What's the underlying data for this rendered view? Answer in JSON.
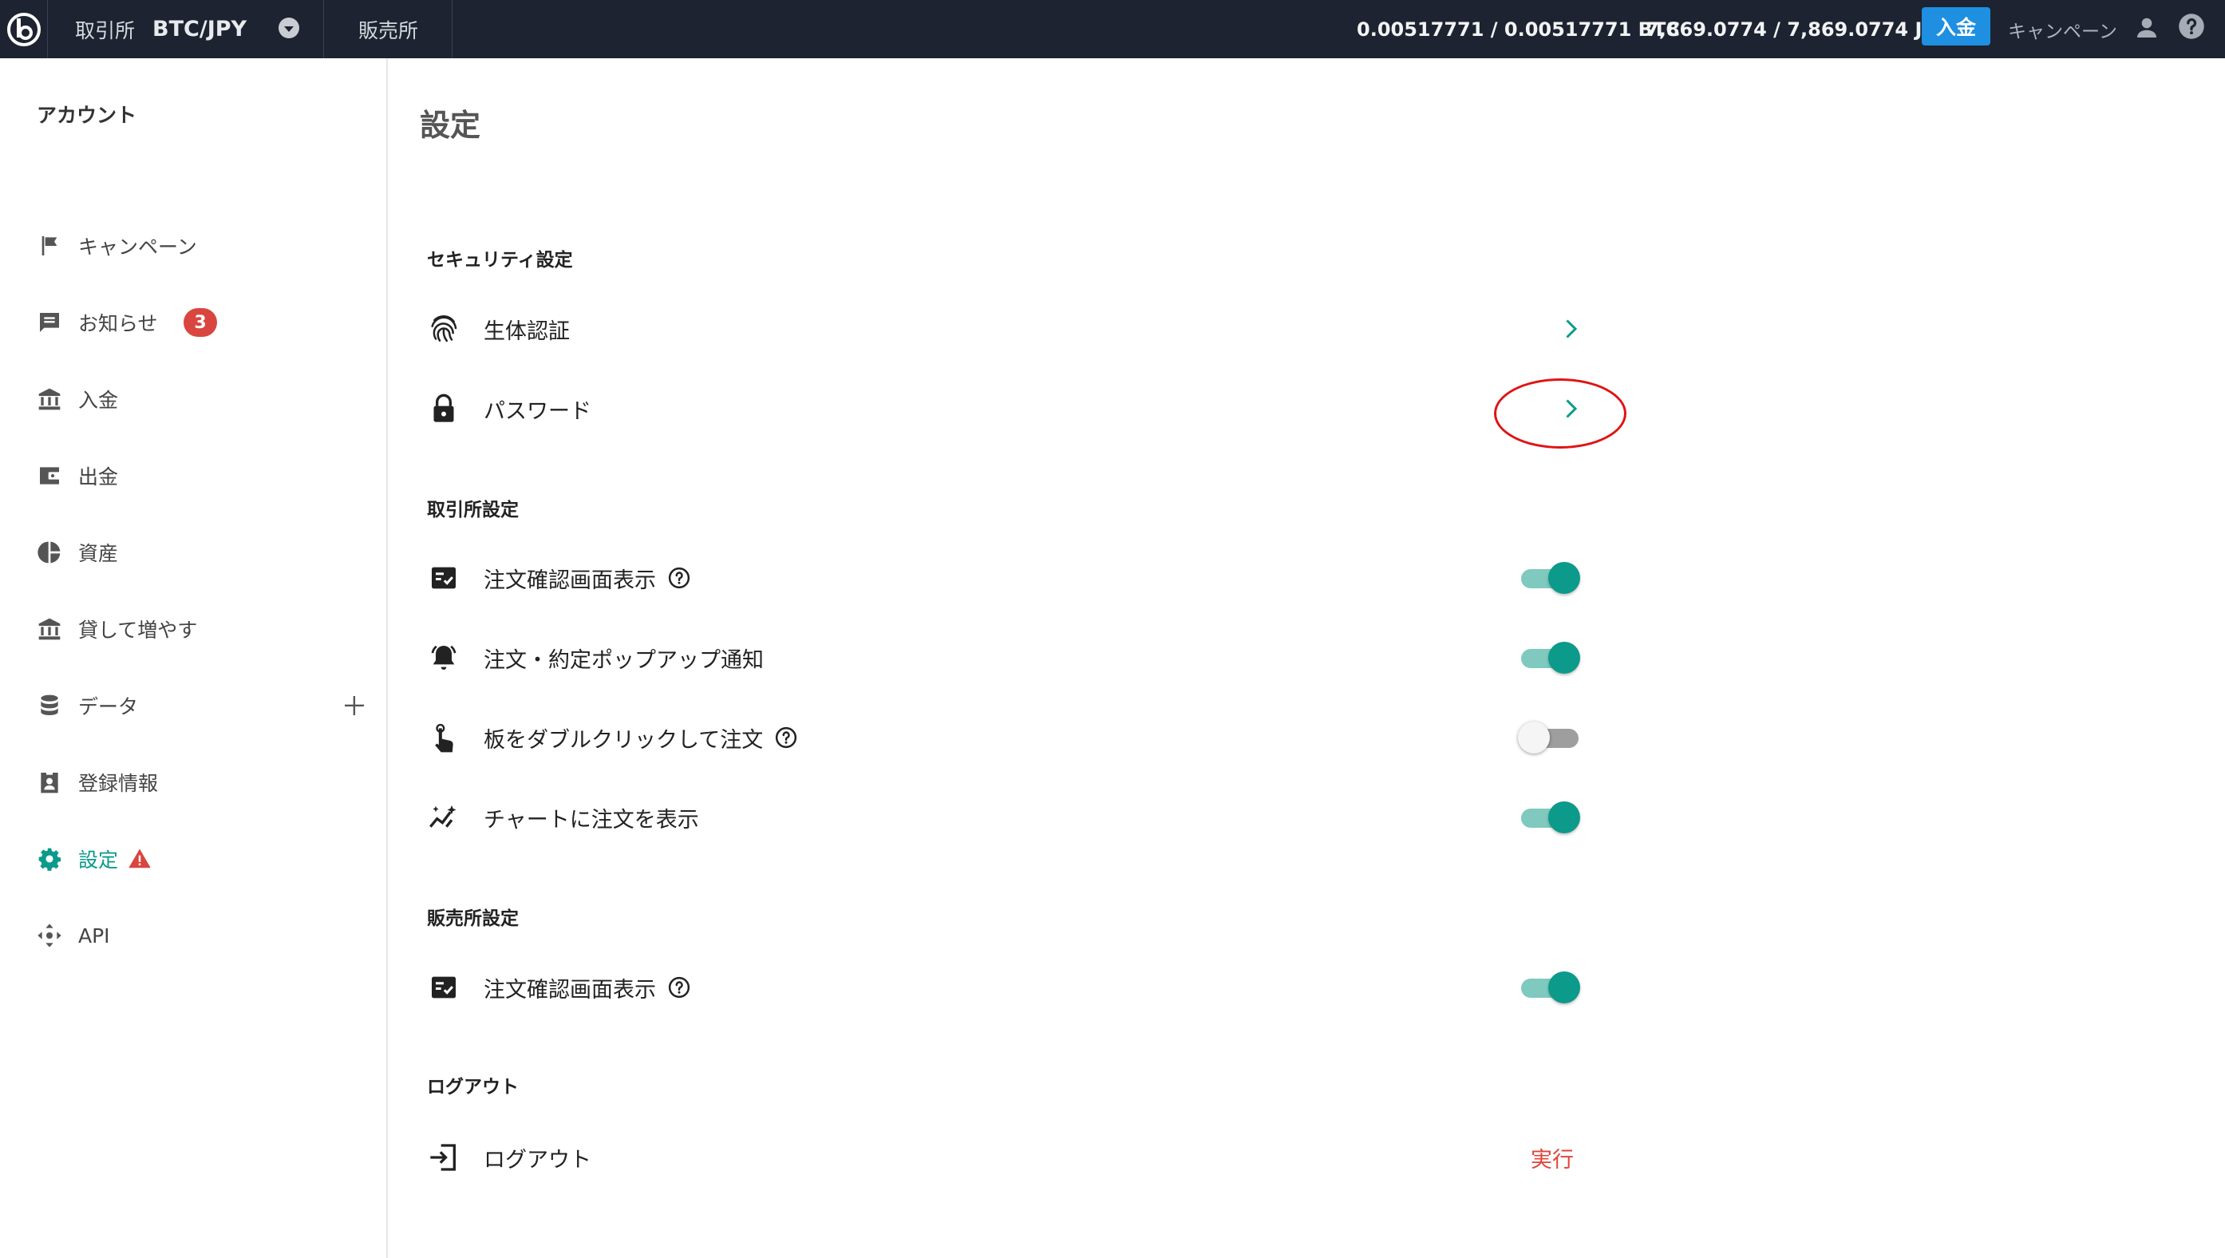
{
  "header": {
    "market_label": "取引所",
    "market_pair": "BTC/JPY",
    "hanbaijo_label": "販売所",
    "btc_balance": "0.00517771 / 0.00517771 BTC",
    "jpy_balance": "7,869.0774 / 7,869.0774 JPY",
    "deposit_label": "入金",
    "campaign_label": "キャンペーン"
  },
  "sidebar": {
    "heading": "アカウント",
    "items": [
      {
        "label": "キャンペーン",
        "icon": "flag-icon"
      },
      {
        "label": "お知らせ",
        "icon": "message-icon",
        "badge": "3"
      },
      {
        "label": "入金",
        "icon": "bank-icon"
      },
      {
        "label": "出金",
        "icon": "wallet-icon"
      },
      {
        "label": "資産",
        "icon": "pie-chart-icon"
      },
      {
        "label": "貸して増やす",
        "icon": "bank-icon"
      },
      {
        "label": "データ",
        "icon": "database-icon"
      },
      {
        "label": "登録情報",
        "icon": "badge-id-icon"
      },
      {
        "label": "設定",
        "icon": "gear-icon"
      },
      {
        "label": "API",
        "icon": "move-arrows-icon"
      }
    ]
  },
  "main": {
    "title": "設定",
    "security": {
      "title": "セキュリティ設定",
      "biometric_label": "生体認証",
      "password_label": "パスワード"
    },
    "exchange": {
      "title": "取引所設定",
      "order_confirm_label": "注文確認画面表示",
      "order_confirm_on": true,
      "popup_label": "注文・約定ポップアップ通知",
      "popup_on": true,
      "doubleclick_label": "板をダブルクリックして注文",
      "doubleclick_on": false,
      "chart_orders_label": "チャートに注文を表示",
      "chart_orders_on": true
    },
    "sales": {
      "title": "販売所設定",
      "order_confirm_label": "注文確認画面表示",
      "order_confirm_on": true
    },
    "logout": {
      "title": "ログアウト",
      "label": "ログアウト",
      "action_label": "実行"
    }
  },
  "colors": {
    "header_bg": "#1d2330",
    "accent": "#0c9a8a",
    "deposit_button": "#1e8fe1",
    "badge": "#d9463f",
    "danger_text": "#e0443b",
    "annotation": "#e01414"
  }
}
